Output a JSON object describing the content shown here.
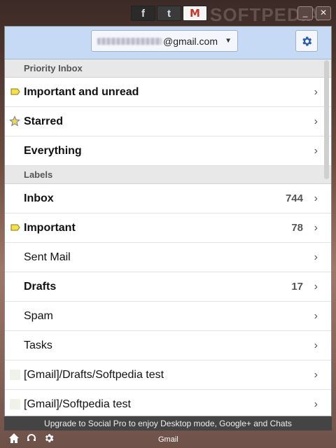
{
  "titlebar": {
    "icons": [
      "f",
      "t",
      "M"
    ],
    "watermark": "SOFTPEDIA",
    "minimize": "_",
    "close": "✕"
  },
  "header": {
    "account_domain": "@gmail.com"
  },
  "sections": {
    "priority": "Priority Inbox",
    "labels": "Labels"
  },
  "priority_items": [
    {
      "label": "Important and unread",
      "count": ""
    },
    {
      "label": "Starred",
      "count": ""
    },
    {
      "label": "Everything",
      "count": ""
    }
  ],
  "label_items": [
    {
      "label": "Inbox",
      "count": "744"
    },
    {
      "label": "Important",
      "count": "78"
    },
    {
      "label": "Sent Mail",
      "count": ""
    },
    {
      "label": "Drafts",
      "count": "17"
    },
    {
      "label": "Spam",
      "count": ""
    },
    {
      "label": "Tasks",
      "count": ""
    },
    {
      "label": "[Gmail]/Drafts/Softpedia test",
      "count": ""
    },
    {
      "label": "[Gmail]/Softpedia test",
      "count": ""
    }
  ],
  "chevron": "›",
  "promo": "Upgrade to Social Pro to enjoy Desktop mode, Google+ and Chats",
  "taskbar": {
    "label": "Gmail"
  },
  "colors": {
    "header_bg": "#c6d9f5",
    "important_marker": "#f4e04a",
    "star": "#f6d64d"
  }
}
